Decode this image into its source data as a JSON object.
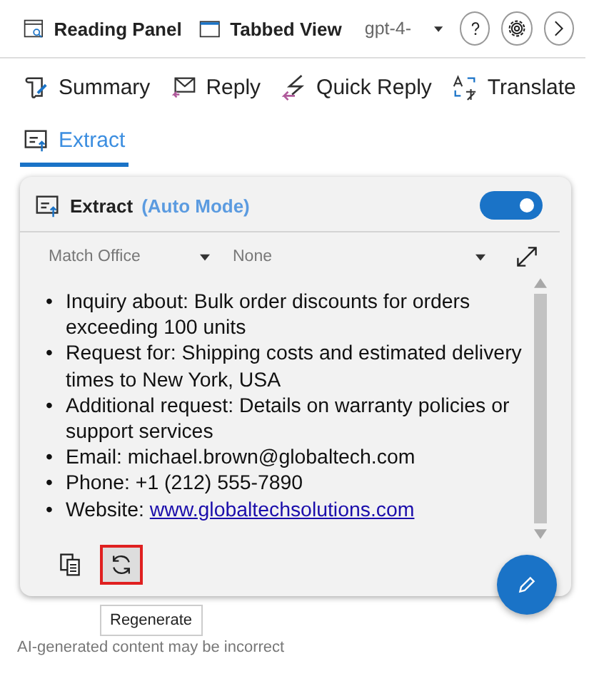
{
  "top_bar": {
    "reading_panel": "Reading Panel",
    "tabbed_view": "Tabbed View",
    "model": "gpt-4-"
  },
  "tabs": [
    {
      "label": "Summary",
      "selected": false,
      "kind": "summary"
    },
    {
      "label": "Reply",
      "selected": false,
      "kind": "reply"
    },
    {
      "label": "Quick Reply",
      "selected": false,
      "kind": "quick"
    },
    {
      "label": "Translate",
      "selected": false,
      "kind": "translate"
    },
    {
      "label": "Extract",
      "selected": true,
      "kind": "extract"
    }
  ],
  "card": {
    "title": "Extract",
    "mode": "(Auto Mode)",
    "auto_on": true,
    "filter_1": "Match Office",
    "filter_2": "None",
    "items": [
      {
        "marker": "•",
        "text": "Inquiry about: Bulk order discounts for orders exceeding 100 units"
      },
      {
        "marker": "•",
        "text": "Request for: Shipping costs and estimated delivery times to New York, USA"
      },
      {
        "marker": "•",
        "text": "Additional request: Details on warranty policies or support services"
      },
      {
        "marker": "•",
        "text": "Email: michael.brown@globaltech.com"
      },
      {
        "marker": "•",
        "text": "Phone: +1 (212) 555-7890"
      },
      {
        "marker": "•",
        "text": "Website: ",
        "link": "www.globaltechsolutions.com"
      }
    ],
    "actions": [
      {
        "kind": "copy",
        "highlighted": false
      },
      {
        "kind": "regenerate",
        "highlighted": true
      }
    ],
    "tooltip": "Regenerate"
  },
  "footer": "AI-generated content may be incorrect"
}
